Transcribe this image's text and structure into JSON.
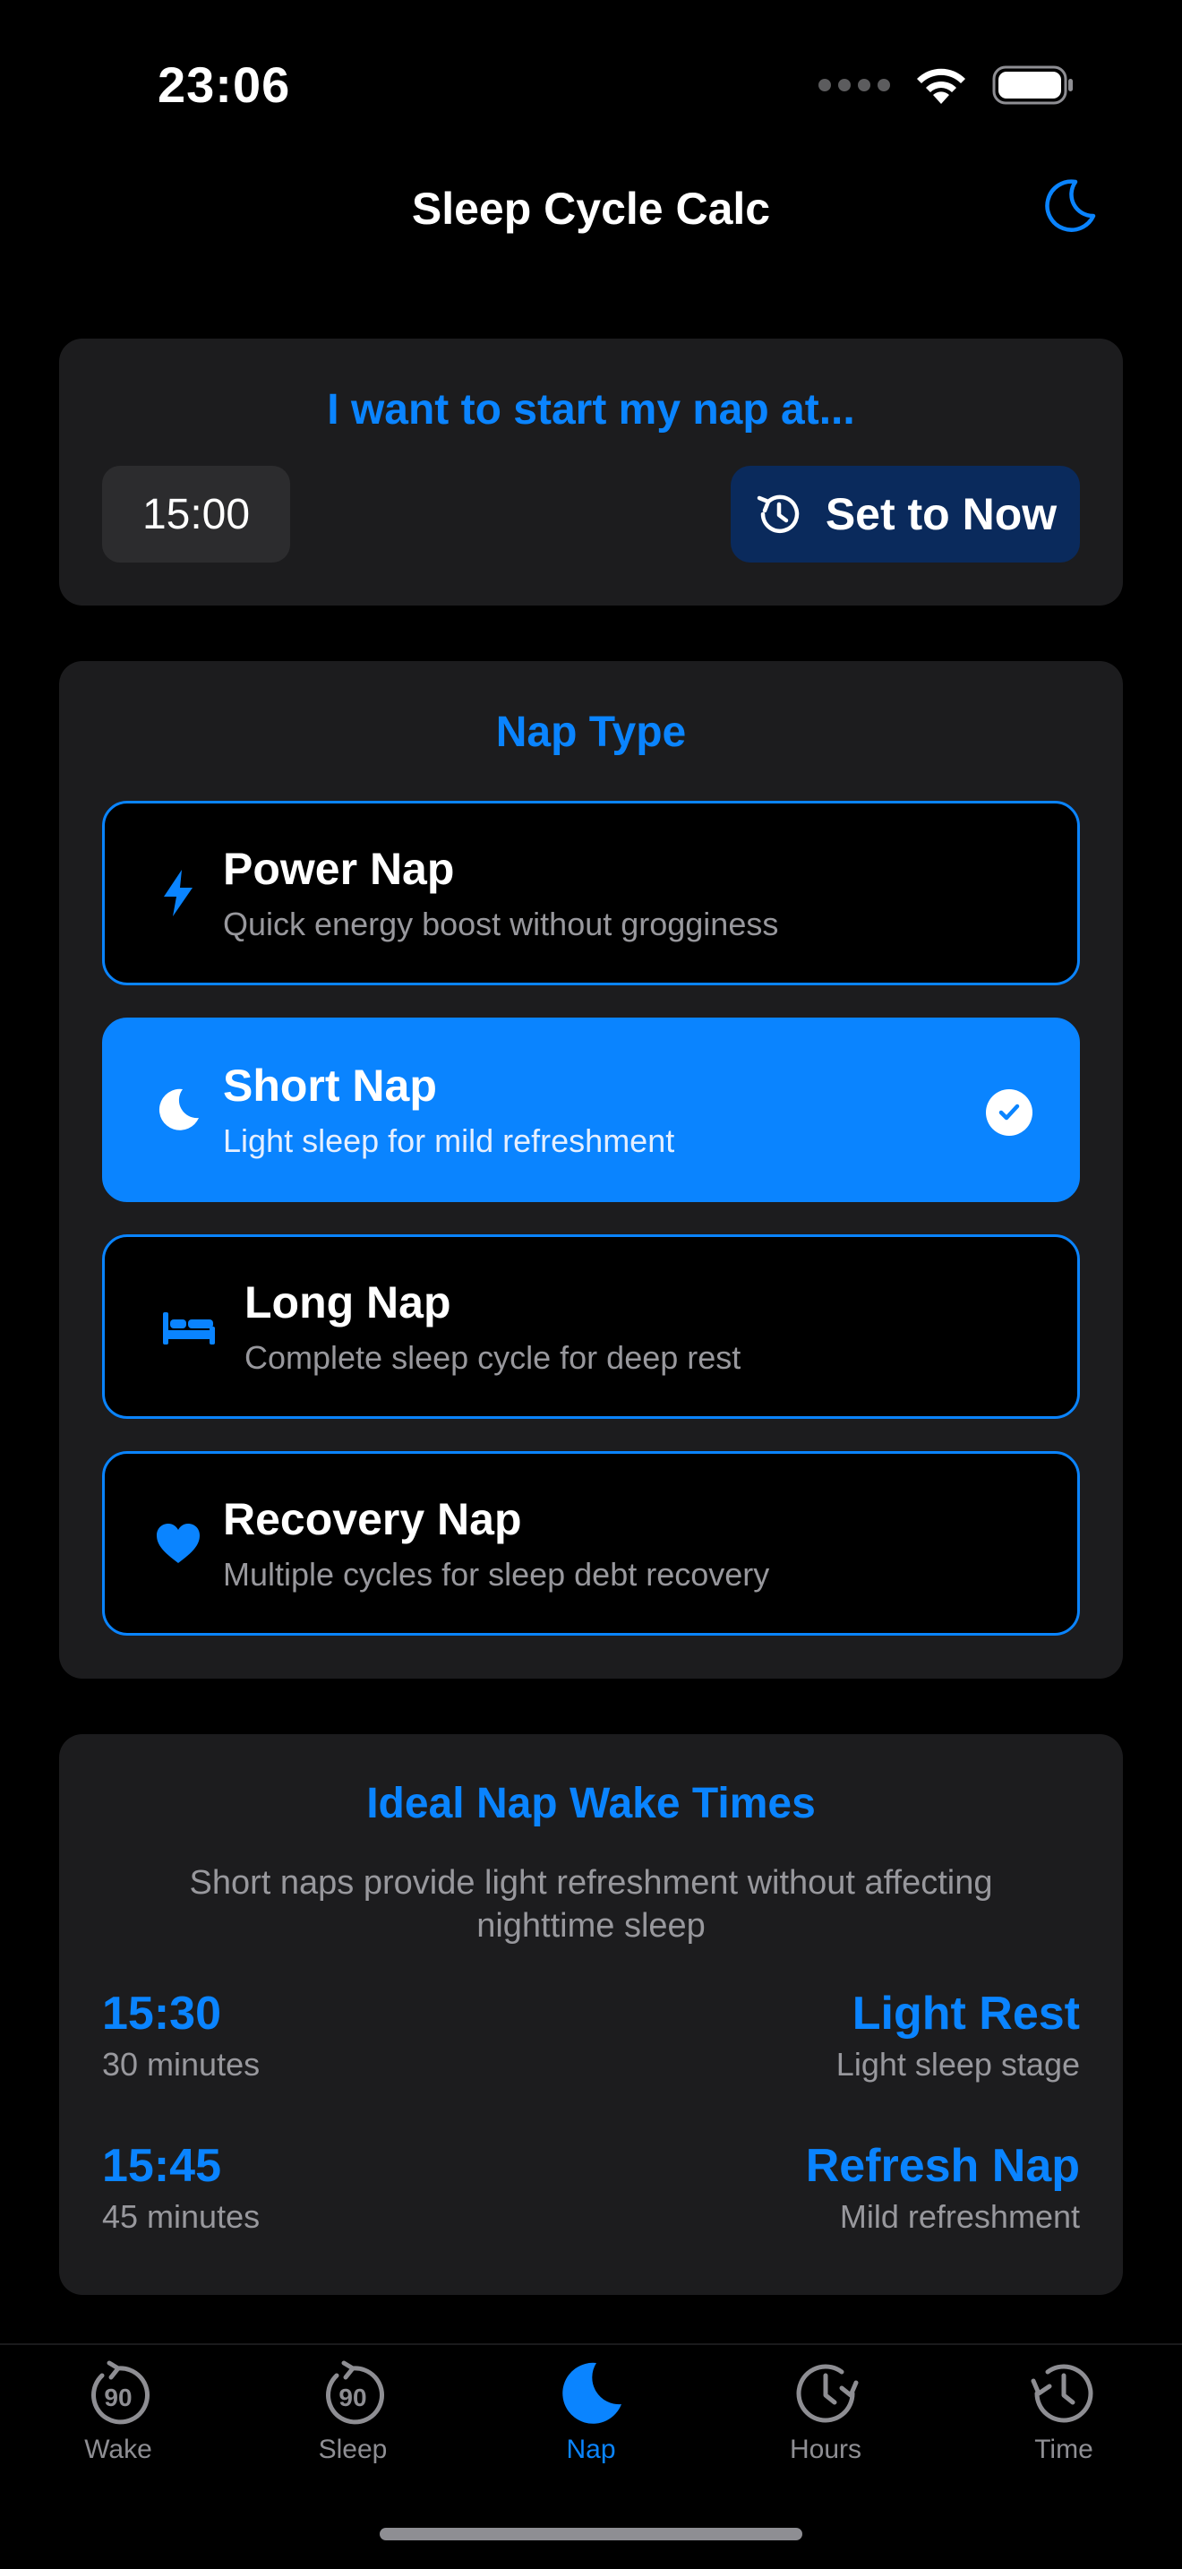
{
  "status": {
    "time": "23:06"
  },
  "nav": {
    "title": "Sleep Cycle Calc",
    "toggle_icon": "moon-icon"
  },
  "start_card": {
    "title": "I want to start my nap at...",
    "time_value": "15:00",
    "now_button_label": "Set to Now"
  },
  "nap_type": {
    "title": "Nap Type",
    "options": [
      {
        "title": "Power Nap",
        "subtitle": "Quick energy boost without grogginess",
        "icon": "bolt-icon",
        "selected": false
      },
      {
        "title": "Short Nap",
        "subtitle": "Light sleep for mild refreshment",
        "icon": "moon-icon",
        "selected": true
      },
      {
        "title": "Long Nap",
        "subtitle": "Complete sleep cycle for deep rest",
        "icon": "bed-icon",
        "selected": false
      },
      {
        "title": "Recovery Nap",
        "subtitle": "Multiple cycles for sleep debt recovery",
        "icon": "heart-icon",
        "selected": false
      }
    ]
  },
  "wake_times": {
    "title": "Ideal Nap Wake Times",
    "description": "Short naps provide light refreshment without affecting nighttime sleep",
    "rows": [
      {
        "time": "15:30",
        "duration": "30 minutes",
        "label": "Light Rest",
        "stage": "Light sleep stage"
      },
      {
        "time": "15:45",
        "duration": "45 minutes",
        "label": "Refresh Nap",
        "stage": "Mild refreshment"
      }
    ]
  },
  "tabs": [
    {
      "label": "Wake",
      "icon": "cycle-90-icon",
      "badge": "90",
      "active": false
    },
    {
      "label": "Sleep",
      "icon": "cycle-90-icon",
      "badge": "90",
      "active": false
    },
    {
      "label": "Nap",
      "icon": "moon-icon",
      "active": true
    },
    {
      "label": "Hours",
      "icon": "clock-forward-icon",
      "active": false
    },
    {
      "label": "Time",
      "icon": "clock-back-icon",
      "active": false
    }
  ],
  "colors": {
    "accent": "#0a84ff",
    "card": "#1c1c1e",
    "background": "#000000",
    "secondary_text": "#98989d"
  }
}
